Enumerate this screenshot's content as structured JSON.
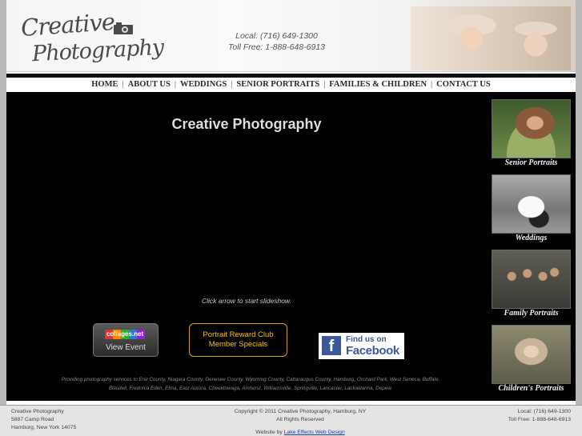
{
  "header": {
    "logo_line1": "Creative",
    "logo_line2": "Photography",
    "phone_local": "Local: (716) 649-1300",
    "phone_tollfree": "Toll Free: 1-888-648-6913"
  },
  "nav": {
    "items": [
      "HOME",
      "ABOUT US",
      "WEDDINGS",
      "SENIOR PORTRAITS",
      "FAMILIES & CHILDREN",
      "CONTACT US"
    ],
    "separator": "|"
  },
  "main": {
    "title": "Creative Photography",
    "slideshow_hint": "Click arrow to start slideshow.",
    "collages_logo": "collages.net",
    "collages_label": "View Event",
    "reward_line1": "Portrait Reward Club",
    "reward_line2": "Member Specials",
    "facebook_line1": "Find us on",
    "facebook_line2": "Facebook",
    "services_line1": "Providing photography services to Erie County, Niagara County, Genesee County, Wyoming County, Cattaraugus County, Hamburg, Orchard Park, West Seneca, Buffalo,",
    "services_line2": "Blasdell, Fredonia Eden, Elma, East Aurora, Cheektowaga, Amherst, Williamsville, Springville, Lancaster, Lackawanna, Depew."
  },
  "sidebar": {
    "items": [
      {
        "label": "Senior Portraits"
      },
      {
        "label": "Weddings"
      },
      {
        "label": "Family Portraits"
      },
      {
        "label": "Children's Portraits"
      }
    ]
  },
  "footer": {
    "name": "Creative Photography",
    "street": "5887 Camp Road",
    "city": "Hamburg, New York 14075",
    "copyright": "Copyright © 2011 Creative Photography, Hamburg, NY",
    "rights": "All Rights Reserved",
    "credit_prefix": "Website by",
    "credit_link": "Lake Effects Web Design",
    "phone_local": "Local: (716) 649-1300",
    "phone_tollfree": "Toll Free: 1-888-648-6913"
  },
  "colors": {
    "main_bg": "#000000",
    "reward_gold": "#f3c300",
    "facebook_blue": "#3b5998",
    "link_blue": "#1a3e9a"
  }
}
